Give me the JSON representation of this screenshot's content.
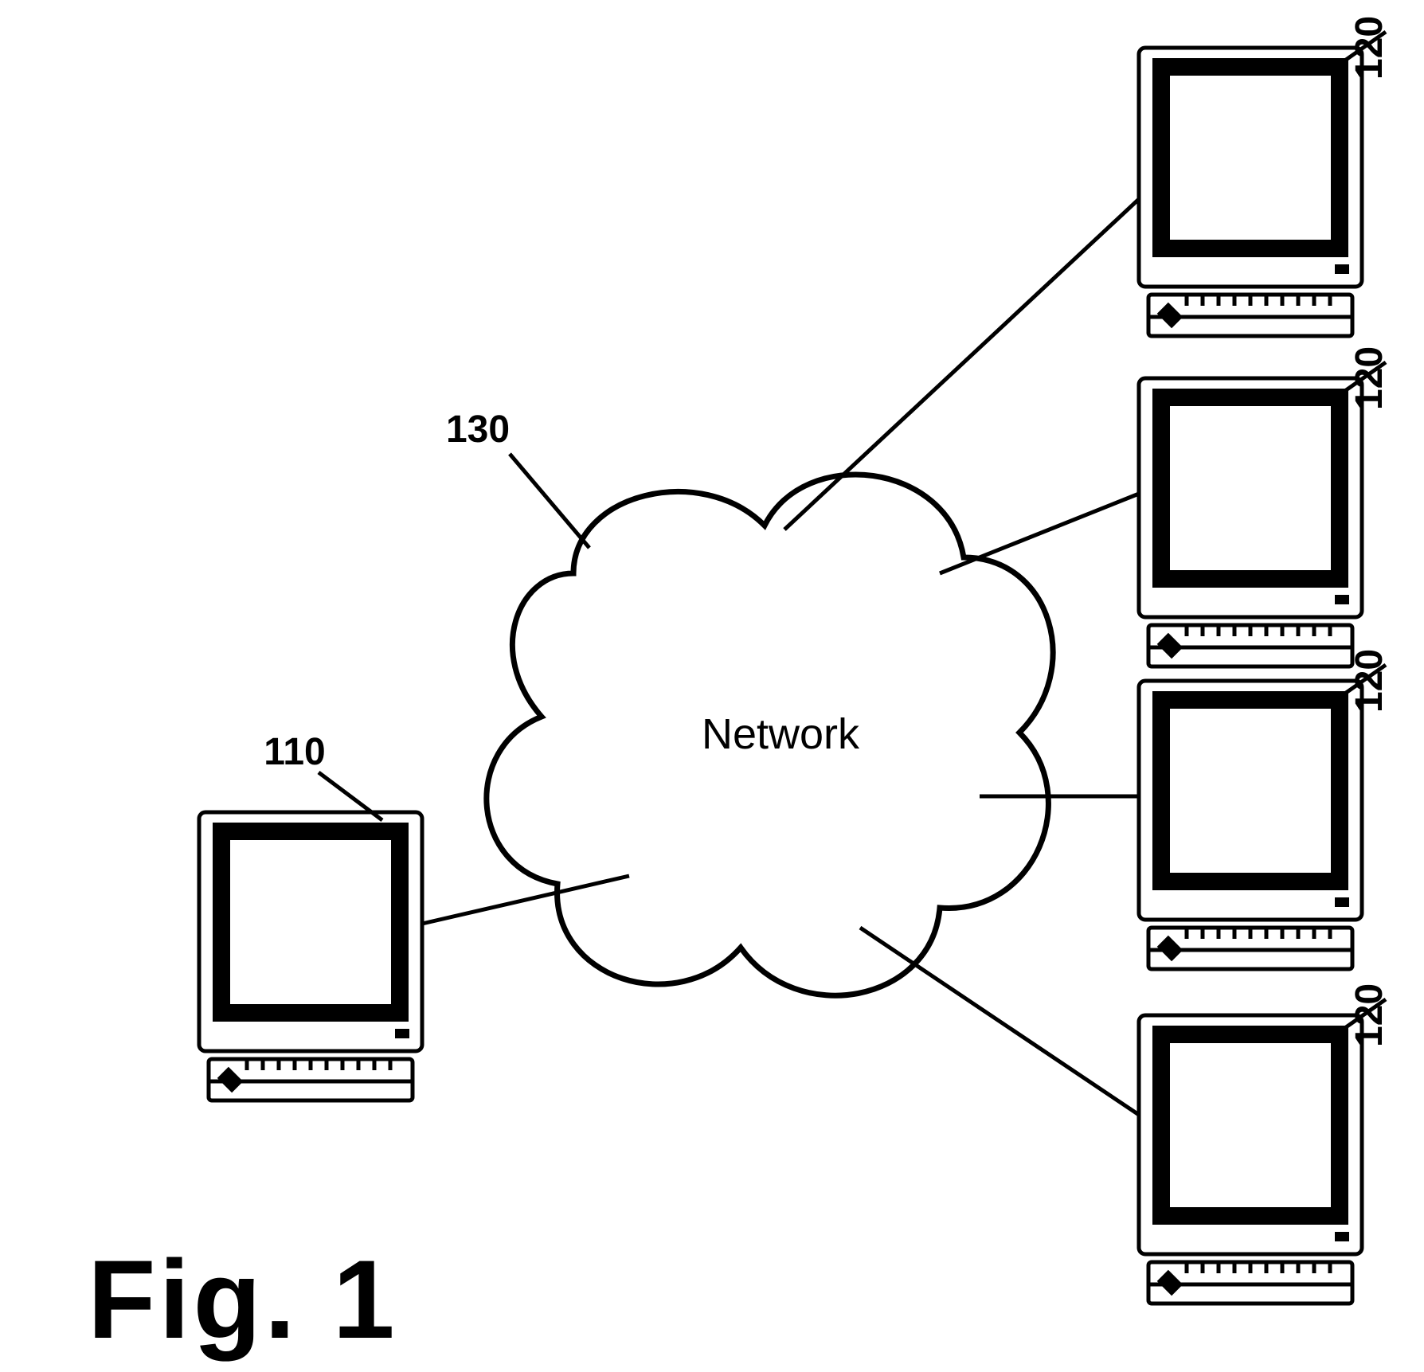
{
  "figure_label": "Fig. 1",
  "network_label": "Network",
  "network_ref": "130",
  "server": {
    "ref": "110"
  },
  "clients": [
    {
      "ref": "120"
    },
    {
      "ref": "120"
    },
    {
      "ref": "120"
    },
    {
      "ref": "120"
    }
  ]
}
